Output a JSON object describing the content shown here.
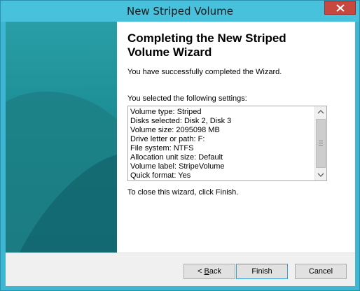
{
  "window": {
    "title": "New Striped Volume"
  },
  "wizard": {
    "heading": "Completing the New Striped\nVolume Wizard",
    "success_text": "You have successfully completed the Wizard.",
    "settings_label": "You selected the following settings:",
    "settings": [
      "Volume type: Striped",
      "Disks selected: Disk 2, Disk 3",
      "Volume size: 2095098 MB",
      "Drive letter or path: F:",
      "File system: NTFS",
      "Allocation unit size: Default",
      "Volume label: StripeVolume",
      "Quick format: Yes"
    ],
    "close_note": "To close this wizard, click Finish."
  },
  "buttons": {
    "back_prefix": "< ",
    "back_mnemonic": "B",
    "back_rest": "ack",
    "finish": "Finish",
    "cancel": "Cancel"
  },
  "icons": {
    "close": "close-icon",
    "scroll_up": "chevron-up-icon",
    "scroll_down": "chevron-down-icon"
  },
  "colors": {
    "titlebar": "#48c1dd",
    "close_button": "#c7483e",
    "banner": "#1d7f86"
  }
}
